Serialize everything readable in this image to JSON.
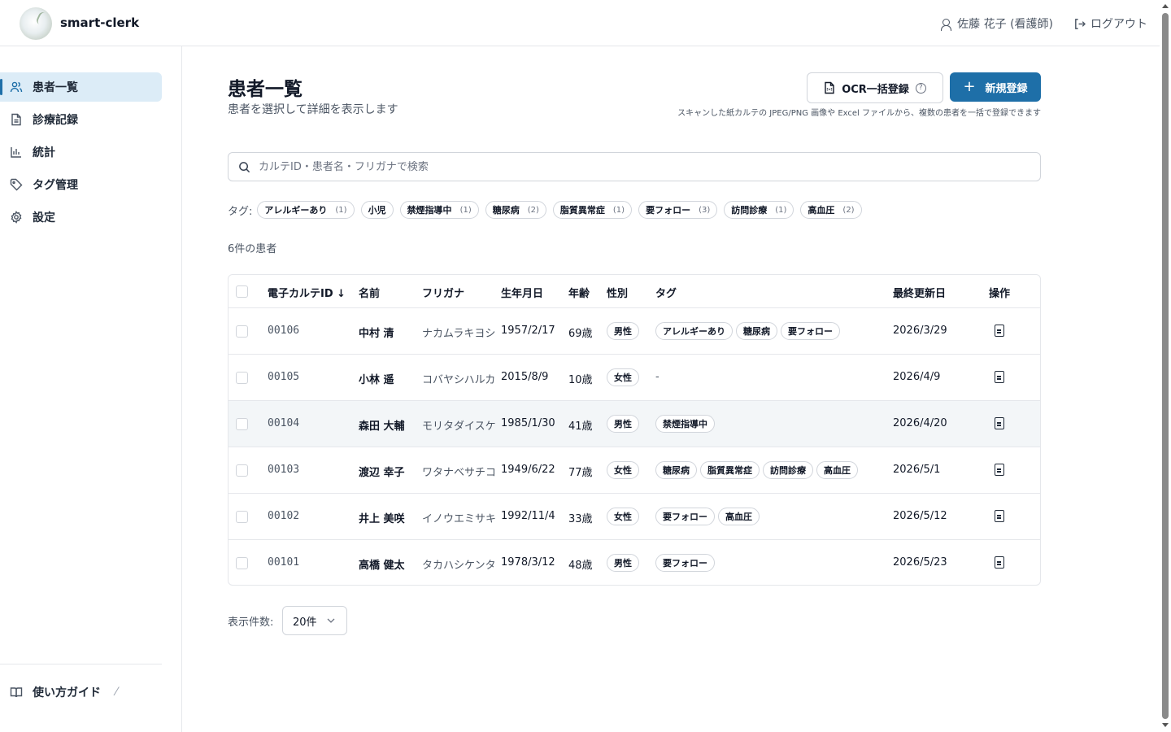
{
  "app": {
    "name": "smart-clerk"
  },
  "header": {
    "user": "佐藤 花子 (看護師)",
    "logout": "ログアウト"
  },
  "sidebar": {
    "items": [
      {
        "label": "患者一覧",
        "icon": "users-icon",
        "active": true
      },
      {
        "label": "診療記録",
        "icon": "document-icon",
        "active": false
      },
      {
        "label": "統計",
        "icon": "bar-chart-icon",
        "active": false
      },
      {
        "label": "タグ管理",
        "icon": "tag-icon",
        "active": false
      },
      {
        "label": "設定",
        "icon": "gear-icon",
        "active": false
      }
    ],
    "guide": "使い方ガイド"
  },
  "page": {
    "title": "患者一覧",
    "subtitle": "患者を選択して詳細を表示します",
    "ocr_button": "OCR一括登録",
    "new_button": "新規登録",
    "ocr_note": "スキャンした紙カルテの JPEG/PNG 画像や Excel ファイルから、複数の患者を一括で登録できます",
    "search_placeholder": "カルテID・患者名・フリガナで検索",
    "tag_label": "タグ:",
    "count": "6件の患者",
    "per_page_label": "表示件数:",
    "per_page_value": "20件"
  },
  "tag_filters": [
    {
      "label": "アレルギーあり",
      "count": "(1)"
    },
    {
      "label": "小児",
      "count": ""
    },
    {
      "label": "禁煙指導中",
      "count": "(1)"
    },
    {
      "label": "糖尿病",
      "count": "(2)"
    },
    {
      "label": "脂質異常症",
      "count": "(1)"
    },
    {
      "label": "要フォロー",
      "count": "(3)"
    },
    {
      "label": "訪問診療",
      "count": "(1)"
    },
    {
      "label": "高血圧",
      "count": "(2)"
    }
  ],
  "table": {
    "headers": [
      "電子カルテID ↓",
      "名前",
      "フリガナ",
      "生年月日",
      "年齢",
      "性別",
      "タグ",
      "最終更新日",
      "操作"
    ],
    "rows": [
      {
        "id": "00106",
        "name": "中村 清",
        "kana": "ナカムラキヨシ",
        "dob": "1957/2/17",
        "age": "69歳",
        "sex": "男性",
        "tags": [
          "アレルギーあり",
          "糖尿病",
          "要フォロー"
        ],
        "updated": "2026/3/29"
      },
      {
        "id": "00105",
        "name": "小林 遥",
        "kana": "コバヤシハルカ",
        "dob": "2015/8/9",
        "age": "10歳",
        "sex": "女性",
        "tags": [],
        "no_tags": "-",
        "updated": "2026/4/9"
      },
      {
        "id": "00104",
        "name": "森田 大輔",
        "kana": "モリタダイスケ",
        "dob": "1985/1/30",
        "age": "41歳",
        "sex": "男性",
        "tags": [
          "禁煙指導中"
        ],
        "updated": "2026/4/20"
      },
      {
        "id": "00103",
        "name": "渡辺 幸子",
        "kana": "ワタナベサチコ",
        "dob": "1949/6/22",
        "age": "77歳",
        "sex": "女性",
        "tags": [
          "糖尿病",
          "脂質異常症",
          "訪問診療",
          "高血圧"
        ],
        "updated": "2026/5/1"
      },
      {
        "id": "00102",
        "name": "井上 美咲",
        "kana": "イノウエミサキ",
        "dob": "1992/11/4",
        "age": "33歳",
        "sex": "女性",
        "tags": [
          "要フォロー",
          "高血圧"
        ],
        "updated": "2026/5/12"
      },
      {
        "id": "00101",
        "name": "高橋 健太",
        "kana": "タカハシケンタ",
        "dob": "1978/3/12",
        "age": "48歳",
        "sex": "男性",
        "tags": [
          "要フォロー"
        ],
        "updated": "2026/5/23"
      }
    ]
  },
  "colors": {
    "accent": "#1e6fa8",
    "active_nav_bg": "#dcecf7",
    "border": "#e5e7eb"
  }
}
